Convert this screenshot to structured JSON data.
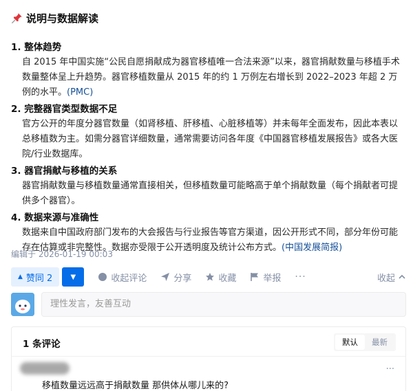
{
  "header": {
    "title": "说明与数据解读",
    "icon": "pushpin-icon"
  },
  "sections": [
    {
      "title": "1. 整体趋势",
      "body": "自 2015 年中国实施“公民自愿捐献成为器官移植唯一合法来源”以来，器官捐献数量与移植手术数量整体呈上升趋势。器官移植数量从 2015 年的约 1 万例左右增长到 2022–2023 年超 2 万例的水平。",
      "link": "(PMC)"
    },
    {
      "title": "2. 完整器官类型数据不足",
      "body": "官方公开的年度分器官数量（如肾移植、肝移植、心脏移植等）并未每年全面发布，因此本表以总移植数为主。如需分器官详细数量，通常需要访问各年度《中国器官移植发展报告》或各大医院/行业数据库。",
      "link": ""
    },
    {
      "title": "3. 器官捐献与移植的关系",
      "body": "器官捐献数量与移植数量通常直接相关，但移植数量可能略高于单个捐献数量（每个捐献者可提供多个器官）。",
      "link": ""
    },
    {
      "title": "4. 数据来源与准确性",
      "body": "数据来自中国政府部门发布的大会报告与行业报告等官方渠道，因公开形式不同，部分年份可能存在估算或非完整性。数据亦受限于公开透明度及统计公布方式。",
      "link": "(中国发展简报)"
    }
  ],
  "meta": {
    "edited": "编辑于 2026-01-19 00:03"
  },
  "actions": {
    "upvote": "赞同 2",
    "collapse_comments": "收起评论",
    "share": "分享",
    "favorite": "收藏",
    "report": "举报",
    "more": "···",
    "collapse": "收起"
  },
  "comment_input": {
    "placeholder": "理性发言，友善互动"
  },
  "comments": {
    "count_label": "1 条评论",
    "sort_default": "默认",
    "sort_latest": "最新",
    "items": [
      {
        "text": "移植数量远远高于捐献数量 那供体从哪儿来的?",
        "more": "···"
      }
    ]
  },
  "colors": {
    "accent": "#056de8",
    "accent_light": "#e5f0ff",
    "muted": "#8590a6",
    "link": "#175199"
  }
}
